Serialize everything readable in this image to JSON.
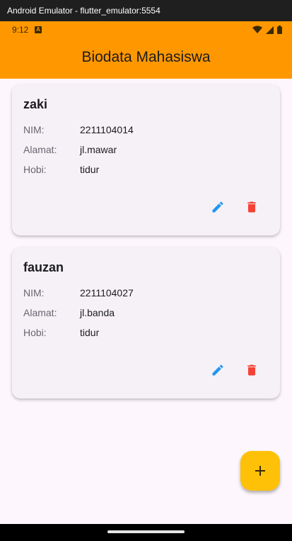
{
  "window": {
    "title": "Android Emulator - flutter_emulator:5554"
  },
  "statusbar": {
    "time": "9:12",
    "notification_icon": "A"
  },
  "appbar": {
    "title": "Biodata Mahasiswa"
  },
  "colors": {
    "appbar": "#ff9800",
    "edit": "#2196f3",
    "delete": "#f44336",
    "fab": "#ffc107"
  },
  "cards": [
    {
      "name": "zaki",
      "fields": [
        {
          "label": "NIM:",
          "value": "2211104014"
        },
        {
          "label": "Alamat:",
          "value": "jl.mawar"
        },
        {
          "label": "Hobi:",
          "value": "tidur"
        }
      ]
    },
    {
      "name": "fauzan",
      "fields": [
        {
          "label": "NIM:",
          "value": "2211104027"
        },
        {
          "label": "Alamat:",
          "value": "jl.banda"
        },
        {
          "label": "Hobi:",
          "value": "tidur"
        }
      ]
    }
  ],
  "icons": {
    "edit": "pencil-icon",
    "delete": "trash-icon",
    "fab": "plus-icon"
  }
}
